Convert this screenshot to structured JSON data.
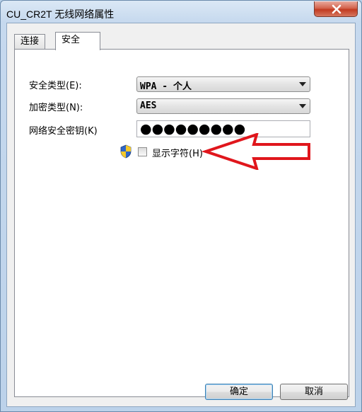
{
  "window": {
    "title": "CU_CR2T 无线网络属性"
  },
  "tabs": [
    {
      "label": "连接",
      "selected": false
    },
    {
      "label": "安全",
      "selected": true
    }
  ],
  "security": {
    "security_type_label": "安全类型(E):",
    "security_type_value": "WPA - 个人",
    "encryption_type_label": "加密类型(N):",
    "encryption_type_value": "AES",
    "network_key_label": "网络安全密钥(K)",
    "network_key_value": "●●●●●●●●●",
    "show_characters_label": "显示字符(H)",
    "show_characters_checked": false
  },
  "buttons": {
    "ok_label": "确定",
    "cancel_label": "取消"
  },
  "colors": {
    "annotation_arrow": "#e0161c",
    "title_bar": "#c6d9ee",
    "close_button": "#c94a30"
  }
}
